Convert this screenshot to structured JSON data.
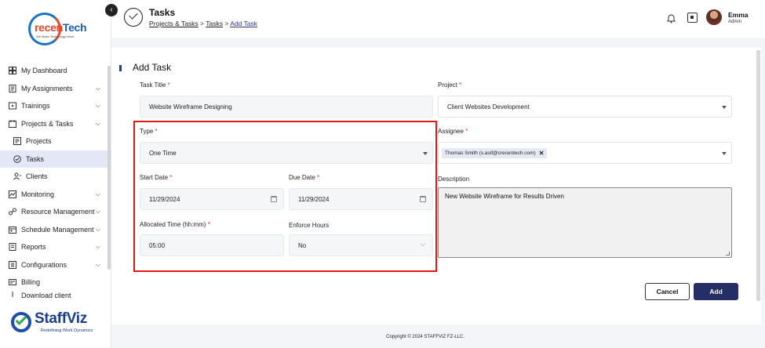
{
  "brand": {
    "logo_text_a": "recen",
    "logo_text_b": "Tech",
    "logo_tagline": "We Make Technology Work",
    "product_name": "StaffViz",
    "product_tagline": "Redefining Work Dynamics"
  },
  "sidebar": {
    "items": [
      {
        "label": "My Dashboard",
        "icon": "dashboard-icon",
        "expandable": false
      },
      {
        "label": "My Assignments",
        "icon": "assignments-icon",
        "expandable": true
      },
      {
        "label": "Trainings",
        "icon": "trainings-icon",
        "expandable": true
      },
      {
        "label": "Projects & Tasks",
        "icon": "projects-tasks-icon",
        "expandable": true
      },
      {
        "label": "Projects",
        "icon": "projects-icon",
        "expandable": false
      },
      {
        "label": "Tasks",
        "icon": "tasks-icon",
        "expandable": false
      },
      {
        "label": "Clients",
        "icon": "clients-icon",
        "expandable": false
      },
      {
        "label": "Monitoring",
        "icon": "monitoring-icon",
        "expandable": true
      },
      {
        "label": "Resource Management",
        "icon": "resource-icon",
        "expandable": true
      },
      {
        "label": "Schedule Management",
        "icon": "schedule-icon",
        "expandable": true
      },
      {
        "label": "Reports",
        "icon": "reports-icon",
        "expandable": true
      },
      {
        "label": "Configurations",
        "icon": "configurations-icon",
        "expandable": true
      },
      {
        "label": "Billing",
        "icon": "billing-icon",
        "expandable": false
      },
      {
        "label": "Download client",
        "icon": "download-icon",
        "expandable": false
      }
    ],
    "active": "Tasks"
  },
  "header": {
    "title": "Tasks",
    "breadcrumb": {
      "root": "Projects & Tasks",
      "sep": ">",
      "middle": "Tasks",
      "current": "Add Task"
    },
    "user": {
      "name": "Emma",
      "role": "Admin"
    }
  },
  "form": {
    "heading": "Add Task",
    "task_title": {
      "label": "Task Title",
      "value": "Website Wireframe Designing"
    },
    "project": {
      "label": "Project",
      "value": "Client Websites Development"
    },
    "type": {
      "label": "Type",
      "value": "One Time"
    },
    "assignee": {
      "label": "Assignee",
      "chip": "Thomas Smith (s.asif@crecentech.com)"
    },
    "start_date": {
      "label": "Start Date",
      "value": "11/29/2024"
    },
    "due_date": {
      "label": "Due Date",
      "value": "11/29/2024"
    },
    "allocated_time": {
      "label": "Allocated Time (hh:mm)",
      "value": "05:00"
    },
    "enforce_hours": {
      "label": "Enforce Hours",
      "value": "No"
    },
    "description": {
      "label": "Description",
      "value": "New Website Wireframe for Results Driven"
    },
    "required_mark": "*",
    "cancel_label": "Cancel",
    "add_label": "Add"
  },
  "footer": {
    "text": "Copyright © 2024 STAFFVIZ FZ-LLC."
  },
  "colors": {
    "primary": "#262e66",
    "highlight": "#e01818",
    "required": "#e03030"
  }
}
